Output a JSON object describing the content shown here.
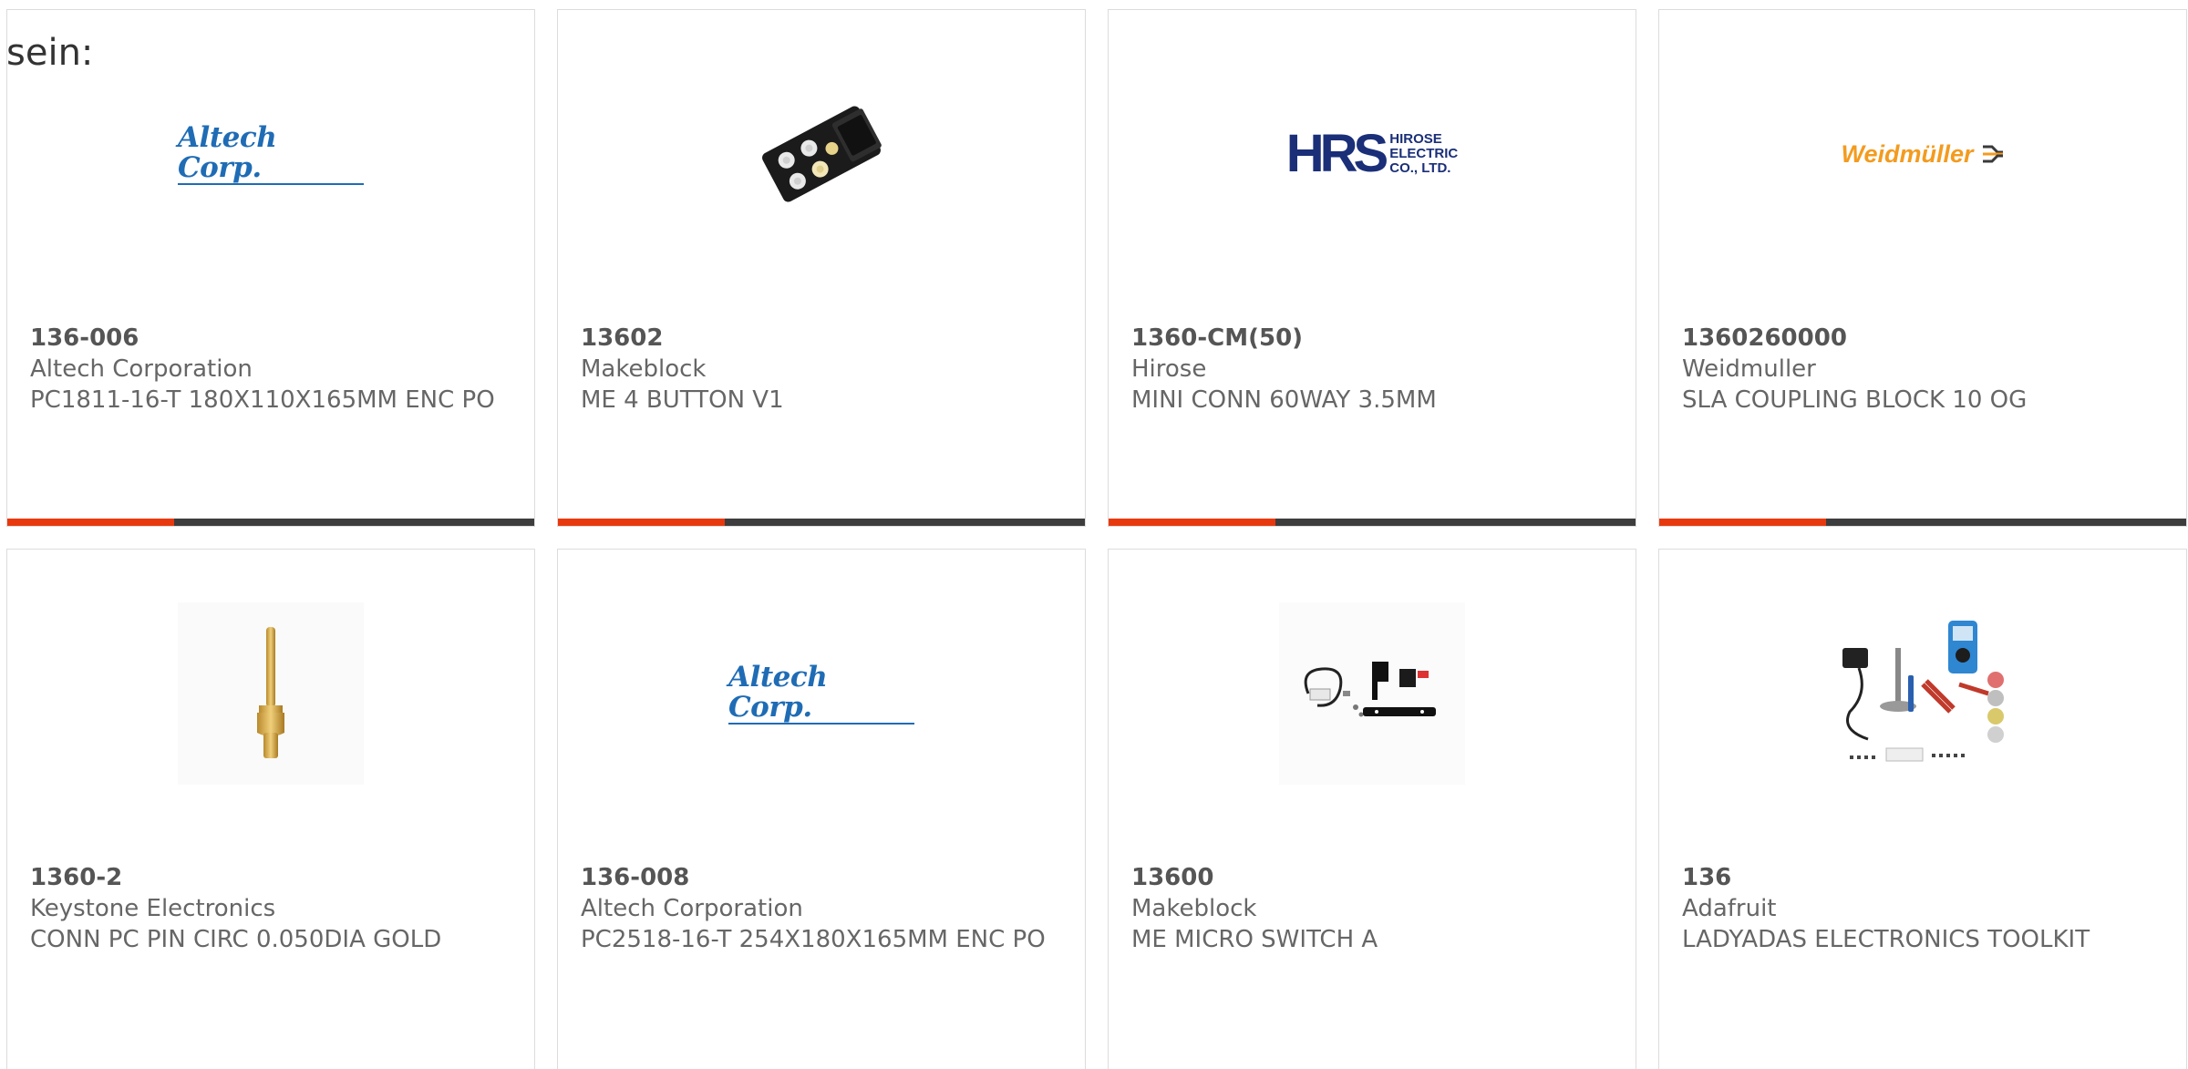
{
  "intro_text": "sein:",
  "colors": {
    "accent": "#e8390e",
    "bar": "#3d3d3d",
    "text": "#666666",
    "border": "#dcdcdc"
  },
  "products": [
    {
      "part_number": "136-006",
      "manufacturer": "Altech Corporation",
      "description": "PC1811-16-T 180X110X165MM ENC PO",
      "image": "altech-logo",
      "logo_text": "Altech Corp."
    },
    {
      "part_number": "13602",
      "manufacturer": "Makeblock",
      "description": "ME 4 BUTTON V1",
      "image": "button-module-photo"
    },
    {
      "part_number": "1360-CM(50)",
      "manufacturer": "Hirose",
      "description": "MINI CONN 60WAY 3.5MM",
      "image": "hirose-logo",
      "logo_text": "HRS",
      "logo_subtext": [
        "HIROSE",
        "ELECTRIC",
        "CO., LTD."
      ]
    },
    {
      "part_number": "1360260000",
      "manufacturer": "Weidmuller",
      "description": "SLA COUPLING BLOCK 10 OG",
      "image": "weidmuller-logo",
      "logo_text": "Weidmüller"
    },
    {
      "part_number": "1360-2",
      "manufacturer": "Keystone Electronics",
      "description": "CONN PC PIN CIRC 0.050DIA GOLD",
      "image": "pc-pin-photo"
    },
    {
      "part_number": "136-008",
      "manufacturer": "Altech Corporation",
      "description": "PC2518-16-T 254X180X165MM ENC PO",
      "image": "altech-logo",
      "logo_text": "Altech Corp."
    },
    {
      "part_number": "13600",
      "manufacturer": "Makeblock",
      "description": "ME MICRO SWITCH A",
      "image": "micro-switch-photo"
    },
    {
      "part_number": "136",
      "manufacturer": "Adafruit",
      "description": "LADYADAS ELECTRONICS TOOLKIT",
      "image": "toolkit-photo"
    }
  ]
}
